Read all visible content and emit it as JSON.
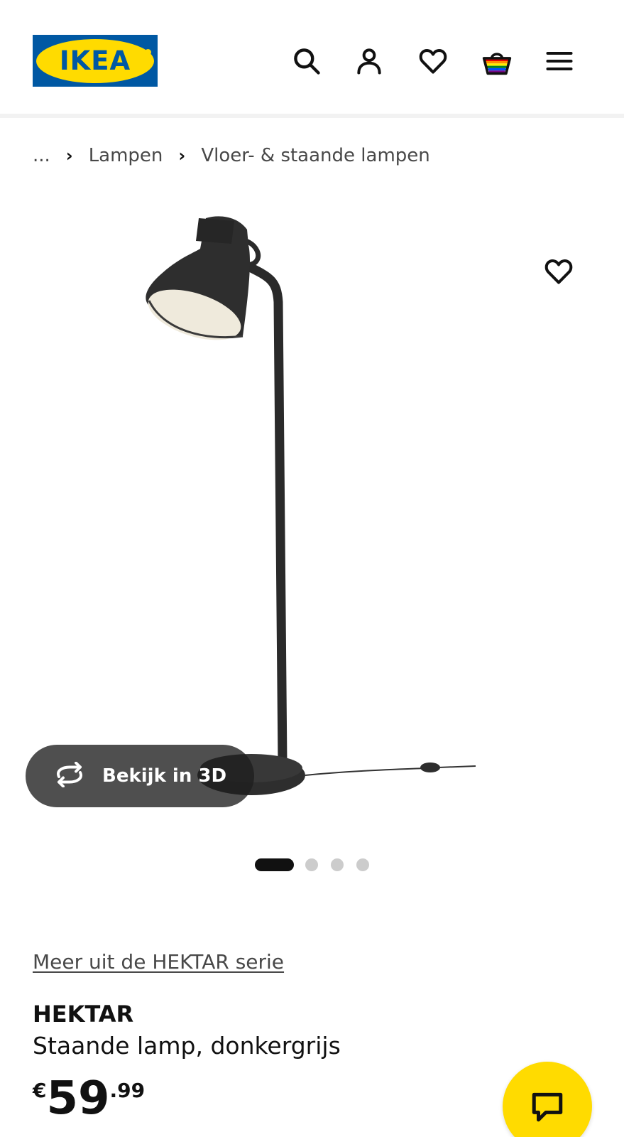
{
  "header": {
    "logo_text": "IKEA",
    "icons": [
      "search-icon",
      "account-icon",
      "favourites-icon",
      "shopping-bag-icon",
      "hamburger-menu-icon"
    ]
  },
  "breadcrumb": {
    "ellipsis": "...",
    "items": [
      "Lampen",
      "Vloer- & staande lampen"
    ]
  },
  "gallery": {
    "view_3d_label": "Bekijk in 3D",
    "image_count": 4,
    "active_index": 0
  },
  "product": {
    "series_link": "Meer uit de HEKTAR serie",
    "name": "HEKTAR",
    "description": "Staande lamp, donkergrijs",
    "price_currency": "€",
    "price_integer": "59",
    "price_decimal": ".99"
  },
  "colors": {
    "brand_blue": "#0058a3",
    "brand_yellow": "#ffdb00",
    "text": "#111111",
    "muted": "#484848"
  }
}
